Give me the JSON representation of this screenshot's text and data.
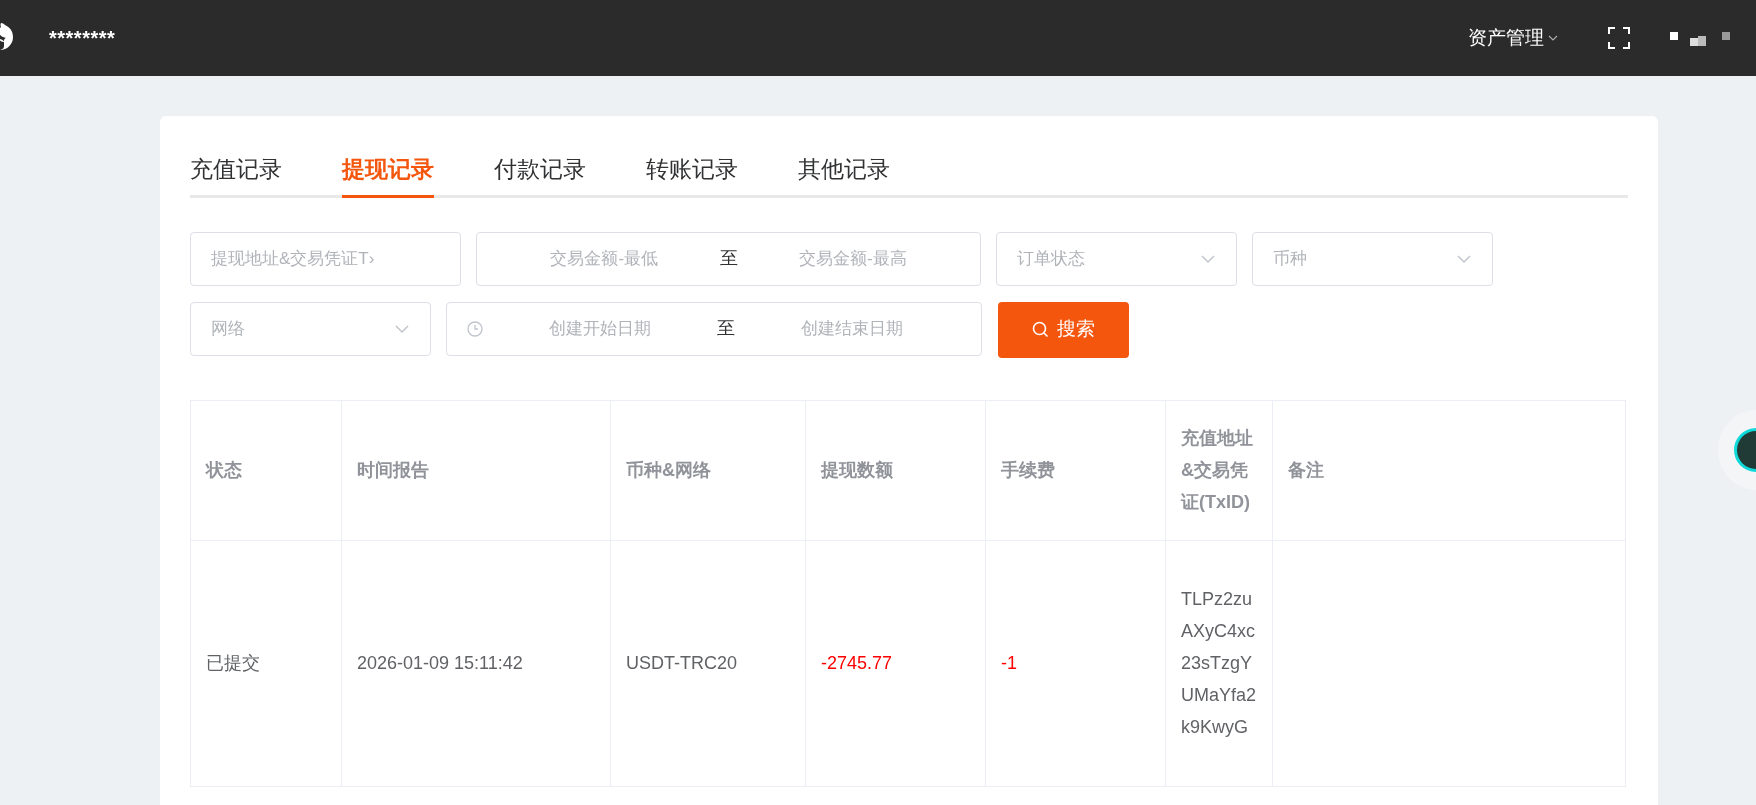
{
  "topbar": {
    "site_name": "********",
    "menu": {
      "label": "资产管理"
    }
  },
  "tabs": [
    {
      "label": "充值记录",
      "selected": false
    },
    {
      "label": "提现记录",
      "selected": true
    },
    {
      "label": "付款记录",
      "selected": false
    },
    {
      "label": "转账记录",
      "selected": false
    },
    {
      "label": "其他记录",
      "selected": false
    }
  ],
  "filters": [
    {
      "kind": "text",
      "placeholder": "提现地址&交易凭证T›"
    },
    {
      "kind": "range",
      "from_placeholder": "交易金额-最低",
      "separator": "至",
      "to_placeholder": "交易金额-最高"
    },
    {
      "kind": "select",
      "placeholder": "订单状态"
    },
    {
      "kind": "select",
      "placeholder": "币种"
    },
    {
      "kind": "select",
      "placeholder": "网络"
    },
    {
      "kind": "date_range",
      "from_placeholder": "创建开始日期",
      "separator": "至",
      "to_placeholder": "创建结束日期"
    },
    {
      "kind": "button",
      "label": "搜索"
    }
  ],
  "table": {
    "columns": [
      "状态",
      "时间报告",
      "币种&网络",
      "提现数额",
      "手续费",
      "充值地址&交易凭证(TxID)",
      "备注"
    ],
    "rows": [
      {
        "cells": [
          {
            "text": "已提交"
          },
          {
            "text": "2026-01-09 15:11:42"
          },
          {
            "text": "USDT-TRC20"
          },
          {
            "text": "-2745.77",
            "color": "#ff0000"
          },
          {
            "text": "-1",
            "color": "#ff0000"
          },
          {
            "text": "TLPz2zuAXyC4xc23sTzgYUMaYfa2k9KwyG"
          }
        ]
      }
    ]
  }
}
